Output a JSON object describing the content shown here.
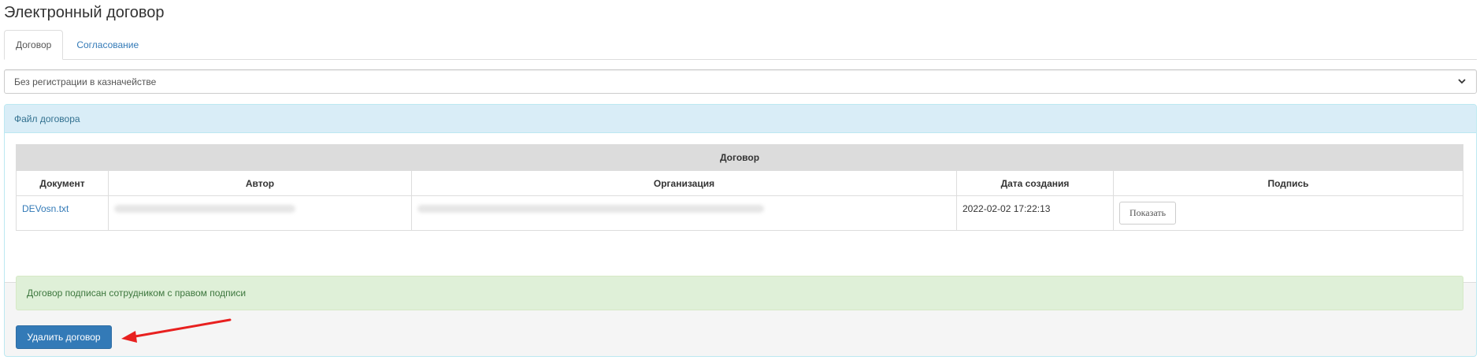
{
  "page": {
    "title": "Электронный договор"
  },
  "tabs": [
    {
      "label": "Договор",
      "active": true
    },
    {
      "label": "Согласование",
      "active": false
    }
  ],
  "registration_select": {
    "selected": "Без регистрации в казначействе",
    "icon": "chevron-down-icon"
  },
  "file_panel": {
    "heading": "Файл договора",
    "table": {
      "caption": "Договор",
      "columns": [
        "Документ",
        "Автор",
        "Организация",
        "Дата создания",
        "Подпись"
      ],
      "rows": [
        {
          "document": "DEVosn.txt",
          "author": "",
          "organization": "",
          "created": "2022-02-02 17:22:13",
          "signature_button": "Показать"
        }
      ]
    }
  },
  "status_alert": "Договор подписан сотрудником с правом подписи",
  "delete_button": "Удалить договор",
  "colors": {
    "primary": "#337ab7",
    "panel_heading_bg": "#d9edf7",
    "success_bg": "#dff0d8",
    "annotation_arrow": "#e8201f"
  }
}
